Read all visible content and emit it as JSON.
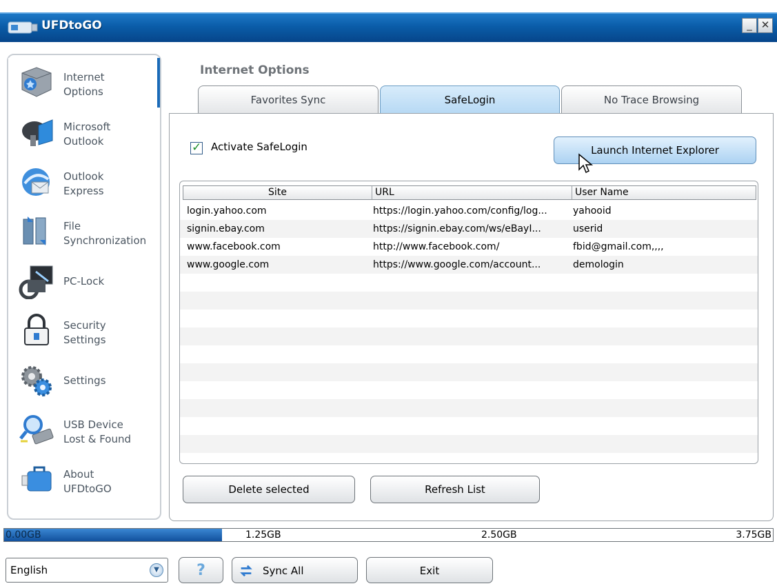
{
  "window": {
    "title": "UFDtoGO",
    "minimize_glyph": "_",
    "close_glyph": "✕"
  },
  "sidebar": {
    "items": [
      {
        "label": "Internet\nOptions",
        "icon": "internet-options-icon",
        "active": true
      },
      {
        "label": "Microsoft\nOutlook",
        "icon": "outlook-icon"
      },
      {
        "label": "Outlook\nExpress",
        "icon": "outlook-express-icon"
      },
      {
        "label": "File\nSynchronization",
        "icon": "file-sync-icon"
      },
      {
        "label": "PC-Lock",
        "icon": "pc-lock-icon"
      },
      {
        "label": "Security\nSettings",
        "icon": "security-lock-icon"
      },
      {
        "label": "Settings",
        "icon": "gears-icon"
      },
      {
        "label": "USB Device\nLost & Found",
        "icon": "usb-search-icon"
      },
      {
        "label": "About\nUFDtoGO",
        "icon": "about-bag-icon"
      }
    ]
  },
  "main": {
    "section_title": "Internet Options",
    "tabs": [
      {
        "label": "Favorites Sync"
      },
      {
        "label": "SafeLogin",
        "active": true
      },
      {
        "label": "No Trace Browsing"
      }
    ],
    "activate_label": "Activate SafeLogin",
    "activate_checked": true,
    "launch_button": "Launch Internet Explorer",
    "list": {
      "columns": [
        "Site",
        "URL",
        "User Name"
      ],
      "rows": [
        [
          "login.yahoo.com",
          "https://login.yahoo.com/config/log...",
          "yahooid"
        ],
        [
          "signin.ebay.com",
          "https://signin.ebay.com/ws/eBayI...",
          "userid"
        ],
        [
          "www.facebook.com",
          "http://www.facebook.com/",
          "fbid@gmail.com,,,,"
        ],
        [
          "www.google.com",
          "https://www.google.com/account...",
          "demologin"
        ]
      ]
    },
    "delete_button": "Delete selected",
    "refresh_button": "Refresh List"
  },
  "storage": {
    "used_fraction": 0.283,
    "labels": [
      "0.00GB",
      "1.25GB",
      "2.50GB",
      "3.75GB"
    ]
  },
  "footer": {
    "language": "English",
    "help_glyph": "?",
    "sync_all": "Sync All",
    "exit": "Exit"
  },
  "colors": {
    "title_bar": "#0a5ca8",
    "storage_fill": "#11509c",
    "active_tab": "#b7d9f4",
    "checkmark": "#1f8f2a"
  }
}
